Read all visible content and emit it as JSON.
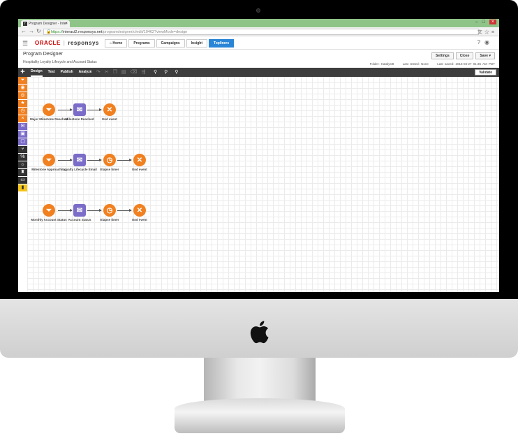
{
  "browser": {
    "tab_title": "Program Designer - Inter",
    "tab_favicon": "r",
    "url_scheme": "https://",
    "url_host": "interact2.responsys.net",
    "url_path": "/programdesigner/c/edit/10462?viewMode=design"
  },
  "app": {
    "logo_oracle": "ORACLE",
    "logo_product": "responsys",
    "nav": [
      {
        "label": "Home"
      },
      {
        "label": "Programs"
      },
      {
        "label": "Campaigns"
      },
      {
        "label": "Insight"
      },
      {
        "label": "Topliners"
      }
    ],
    "active_nav": "Topliners"
  },
  "page": {
    "title": "Program Designer",
    "subtitle": "Hospitality Loyalty Lifecycle and Account Status",
    "buttons": {
      "settings": "Settings",
      "close": "Close",
      "save": "Save"
    },
    "meta": {
      "folder": "Folder: Katalyst8",
      "last_tested": "Last tested: None",
      "last_saved": "Last saved: 2016-03-27 01:36 AM PDT"
    }
  },
  "toolbar": {
    "tabs": [
      "Design",
      "Test",
      "Publish",
      "Analyze"
    ],
    "active_tab": "Design",
    "validate": "Validate"
  },
  "canvas": {
    "row1": [
      "Major Milestone Reached",
      "Milestone Reached",
      "End event"
    ],
    "row2": [
      "Milestone Approaching",
      "Loyalty Lifecycle Email",
      "Elapse timer",
      "End event"
    ],
    "row3": [
      "Monthly Account Status",
      "Account Status",
      "Elapse timer",
      "End event"
    ]
  },
  "colors": {
    "accent": "#2a85d6",
    "orange": "#f08020",
    "purple": "#7a6cc8",
    "toolbar": "#3d3d3d"
  }
}
